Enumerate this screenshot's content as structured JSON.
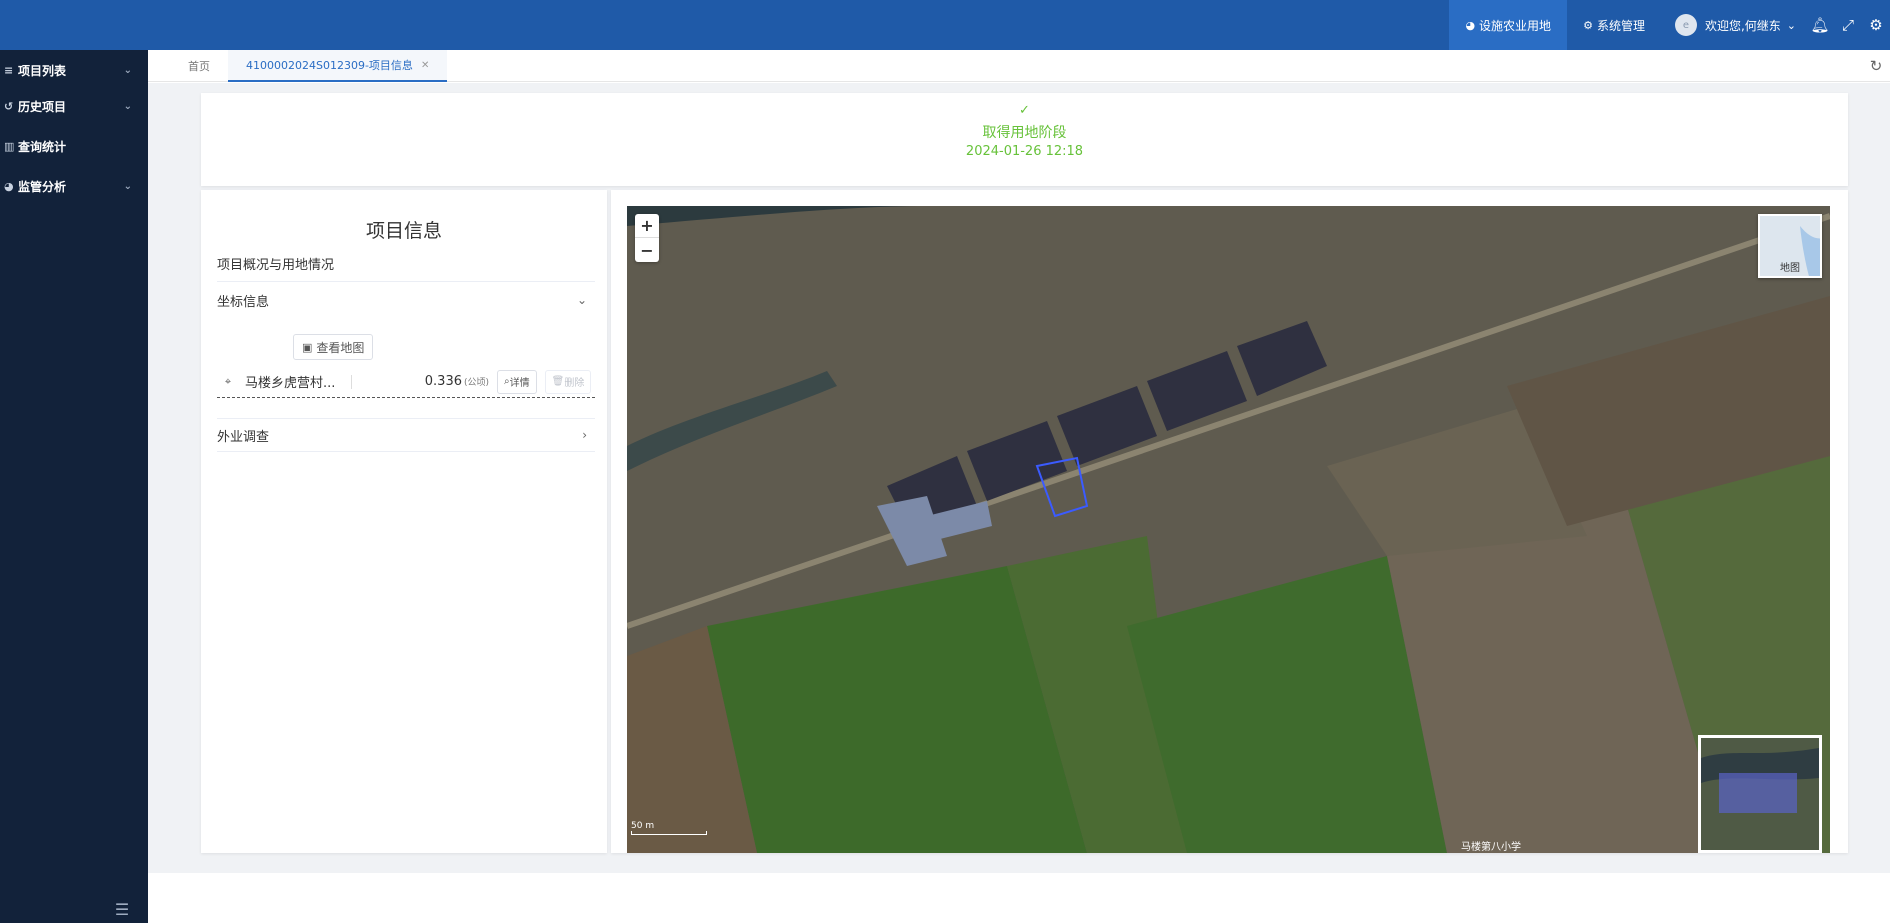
{
  "topbar": {
    "nav": [
      {
        "label": "设施农业用地",
        "icon": "pie-icon",
        "active": true
      },
      {
        "label": "系统管理",
        "icon": "share-icon",
        "active": false
      }
    ],
    "user": {
      "avatar": "e",
      "greeting": "欢迎您,何继东"
    }
  },
  "sidebar": {
    "items": [
      {
        "label": "项目列表",
        "icon": "list-icon",
        "has_arrow": true
      },
      {
        "label": "历史项目",
        "icon": "history-icon",
        "has_arrow": true
      },
      {
        "label": "查询统计",
        "icon": "bar-chart-icon",
        "has_arrow": false
      },
      {
        "label": "监管分析",
        "icon": "pie-icon",
        "has_arrow": true
      }
    ]
  },
  "tabs": {
    "home": "首页",
    "active": "4100002024S012309-项目信息"
  },
  "status": {
    "stage": "取得用地阶段",
    "time": "2024-01-26 12:18",
    "color": "#67c23a"
  },
  "info": {
    "title": "项目信息",
    "overview": "项目概况与用地情况",
    "coords": "坐标信息",
    "view_map": "查看地图",
    "row": {
      "name": "马楼乡虎营村...",
      "area": "0.336",
      "unit": "(公顷)",
      "detail": "详情",
      "delete": "删除"
    },
    "field_survey": "外业调查"
  },
  "map": {
    "zoom_in": "+",
    "zoom_out": "−",
    "layer_label": "地图",
    "scale_text": "50 m",
    "poi_label": "马楼第八小学"
  },
  "colors": {
    "topbar": "#1f5aa8",
    "sidebar": "#12223a",
    "accent": "#2a6dc4"
  }
}
